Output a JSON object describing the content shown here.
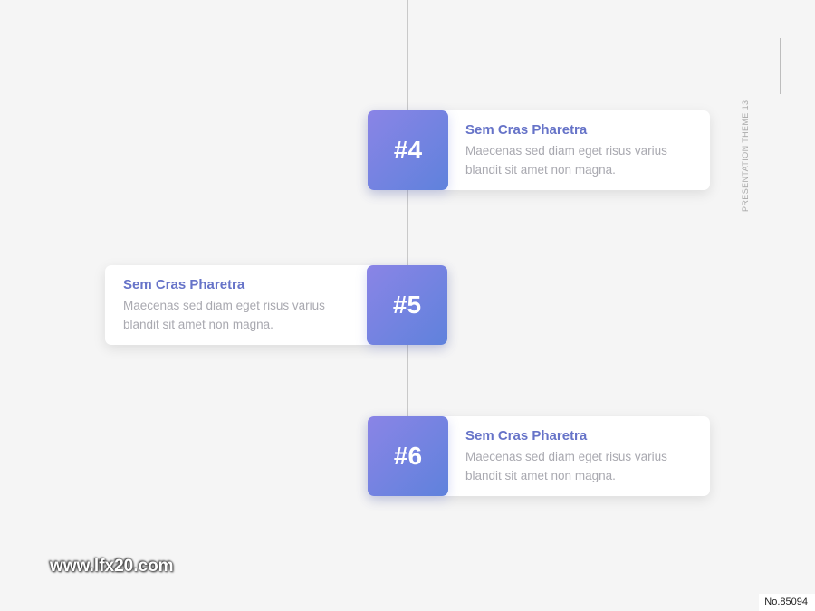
{
  "timeline": {
    "items": [
      {
        "number": "#4",
        "title": "Sem Cras Pharetra",
        "line1": "Maecenas sed diam eget risus varius",
        "line2": "blandit sit amet non magna."
      },
      {
        "number": "#5",
        "title": "Sem Cras Pharetra",
        "line1": "Maecenas sed diam eget risus varius",
        "line2": "blandit sit amet non magna."
      },
      {
        "number": "#6",
        "title": "Sem Cras Pharetra",
        "line1": "Maecenas sed diam eget risus varius",
        "line2": "blandit sit amet non magna."
      }
    ]
  },
  "side_label": "PRESENTATION THEME 13",
  "watermark": "www.lfx20.com",
  "doc_number": "No.85094",
  "colors": {
    "accent_start": "#8a84e6",
    "accent_end": "#5f82dc",
    "title": "#6673c8",
    "body_text": "#a9a9b0",
    "background": "#f5f5f5"
  }
}
